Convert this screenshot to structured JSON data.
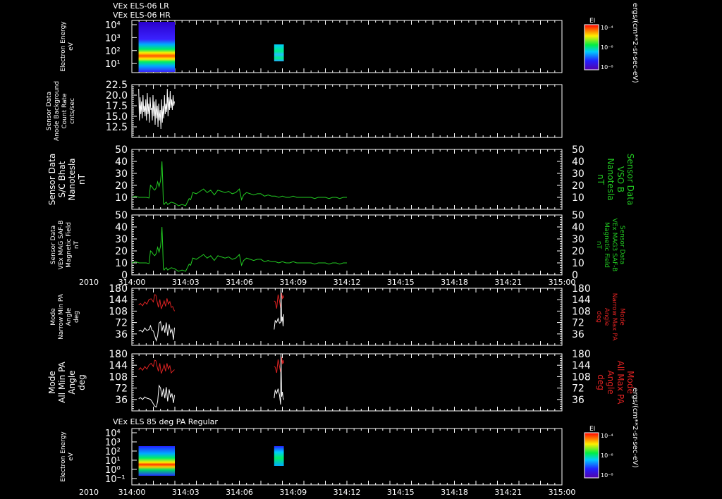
{
  "colors": {
    "background": "#000000",
    "axis": "#ffffff",
    "trace_white": "#ffffff",
    "trace_green": "#22cc22",
    "trace_red": "#dd2222",
    "label_green": "#22cc22",
    "label_red": "#dd2222"
  },
  "header": {
    "line1": "VEx ELS-06 LR",
    "line2": "VEx ELS-06 HR"
  },
  "colorbar_unit": "ergs/(cm**2-sr-sec-eV)",
  "chart_data": [
    {
      "id": "p1",
      "type": "heatmap",
      "ylabel": [
        "Electron Energy",
        "eV"
      ],
      "log_y": true,
      "ytick_labels": [
        "10⁴",
        "10³",
        "10²",
        "10¹"
      ],
      "blocks": [
        {
          "t0": 0.94,
          "t1": 6.0,
          "label": "ELS spectrogram"
        },
        {
          "t0": 19.85,
          "t1": 21.2,
          "label": "ELS spectrogram"
        }
      ],
      "colorbar": {
        "title": "EI",
        "ticks": [
          "10⁻⁴",
          "10⁻⁶",
          "10⁻⁸"
        ]
      }
    },
    {
      "id": "p2",
      "type": "line",
      "ylabel": [
        "Sensor Data",
        "Anode Background",
        "Count Rate",
        "cnts/sec"
      ],
      "ylim": [
        10.0,
        22.5
      ],
      "yticks": [
        "22.5",
        "20.0",
        "17.5",
        "15.0",
        "12.5"
      ],
      "series": [
        {
          "color": "white",
          "x": [
            0.95,
            1.05,
            1.15,
            1.25,
            1.35,
            1.45,
            1.55,
            1.65,
            1.75,
            1.85,
            1.95,
            2.05,
            2.15,
            2.25,
            2.35,
            2.45,
            2.55,
            2.65,
            2.75,
            2.85,
            2.95,
            3.05,
            3.15,
            3.25,
            3.35,
            3.45,
            3.55,
            3.65,
            3.75,
            3.85,
            3.95,
            4.05,
            4.15,
            4.25,
            4.35,
            4.45,
            4.55,
            4.65,
            4.75,
            4.85,
            4.95,
            5.05,
            5.15,
            5.25,
            5.35,
            5.45,
            5.55,
            5.65,
            5.75,
            5.85,
            5.95
          ],
          "y": [
            21.5,
            14.0,
            19.5,
            15.5,
            18.5,
            14.5,
            20.0,
            16.0,
            17.5,
            15.0,
            19.0,
            14.0,
            20.5,
            15.5,
            18.0,
            13.5,
            19.5,
            16.5,
            17.0,
            14.0,
            20.0,
            15.0,
            18.5,
            13.0,
            19.0,
            14.5,
            17.5,
            12.5,
            18.0,
            14.0,
            16.5,
            12.0,
            19.0,
            13.5,
            17.5,
            14.5,
            20.0,
            15.5,
            18.0,
            16.0,
            21.5,
            15.0,
            19.5,
            16.5,
            21.0,
            17.0,
            19.0,
            16.5,
            20.0,
            17.5,
            18.5
          ]
        }
      ]
    },
    {
      "id": "p3",
      "type": "line",
      "ylabel": [
        "Sensor Data",
        "S/C Bhat",
        "Nanotesla",
        "nT"
      ],
      "right_label": [
        "Sensor Data",
        "VSO B",
        "Nanotesla",
        "nT"
      ],
      "ylim": [
        0,
        50
      ],
      "yticks": [
        "50",
        "40",
        "30",
        "20",
        "10"
      ],
      "series": [
        {
          "color": "green",
          "x": [
            0,
            0.5,
            1,
            1.5,
            2,
            2.4,
            2.6,
            2.8,
            3.0,
            3.2,
            3.4,
            3.6,
            3.8,
            4.0,
            4.1,
            4.2,
            4.25,
            4.3,
            4.4,
            4.5,
            4.6,
            4.8,
            5,
            5.5,
            6,
            6.5,
            7,
            7.5,
            8,
            8.2,
            8.5,
            9,
            9.5,
            10,
            10.5,
            11,
            11.5,
            12,
            12.5,
            13,
            13.5,
            14,
            14.5,
            15,
            15.3,
            15.6,
            16,
            16.5,
            17,
            17.5,
            18,
            18.5,
            19,
            19.5,
            20,
            20.5,
            21,
            21.5,
            22,
            22.5,
            23,
            23.5,
            24,
            24.5,
            25,
            25.5,
            26,
            26.5,
            27,
            27.5,
            28,
            28.5,
            29,
            29.5,
            30
          ],
          "y": [
            10,
            11,
            10,
            10,
            10,
            9.5,
            20,
            19,
            17,
            16,
            18,
            23,
            19,
            24,
            30,
            40,
            33,
            25,
            5,
            4,
            5,
            6,
            4,
            6,
            5,
            3,
            4,
            3,
            9,
            8,
            14,
            13,
            15,
            17,
            14,
            16,
            12,
            16,
            15,
            14,
            15,
            13,
            14,
            17,
            8,
            12,
            14,
            13,
            12,
            13,
            13,
            11,
            12,
            11,
            11,
            10,
            11,
            10,
            10,
            11,
            10,
            10,
            10,
            10,
            10,
            9,
            10,
            10,
            10,
            9,
            10,
            10,
            9,
            10,
            10
          ]
        }
      ]
    },
    {
      "id": "p4",
      "type": "line",
      "ylabel": [
        "Sensor Data",
        "VEx MAG SAF-B",
        "Magnetic Field",
        "nT"
      ],
      "right_label": [
        "Sensor Data",
        "VEx MAG3 SAF-B",
        "Magnetic Field",
        "nT"
      ],
      "ylim": [
        0,
        50
      ],
      "yticks": [
        "50",
        "40",
        "30",
        "20",
        "10",
        "0"
      ],
      "series": [
        {
          "color": "green",
          "x": [
            0,
            0.5,
            1,
            1.5,
            2,
            2.4,
            2.6,
            2.8,
            3.0,
            3.2,
            3.4,
            3.6,
            3.8,
            4.0,
            4.1,
            4.2,
            4.25,
            4.3,
            4.4,
            4.5,
            4.6,
            4.8,
            5,
            5.5,
            6,
            6.5,
            7,
            7.5,
            8,
            8.2,
            8.5,
            9,
            9.5,
            10,
            10.5,
            11,
            11.5,
            12,
            12.5,
            13,
            13.5,
            14,
            14.5,
            15,
            15.3,
            15.6,
            16,
            16.5,
            17,
            17.5,
            18,
            18.5,
            19,
            19.5,
            20,
            20.5,
            21,
            21.5,
            22,
            22.5,
            23,
            23.5,
            24,
            24.5,
            25,
            25.5,
            26,
            26.5,
            27,
            27.5,
            28,
            28.5,
            29,
            29.5,
            30
          ],
          "y": [
            10,
            11,
            10,
            10,
            10,
            9.5,
            20,
            19,
            17,
            16,
            18,
            23,
            19,
            24,
            30,
            40,
            33,
            25,
            5,
            4,
            5,
            6,
            4,
            6,
            5,
            3,
            4,
            3,
            9,
            8,
            14,
            13,
            15,
            17,
            14,
            16,
            12,
            16,
            15,
            14,
            15,
            13,
            14,
            17,
            8,
            12,
            14,
            13,
            12,
            13,
            13,
            11,
            12,
            11,
            11,
            10,
            11,
            10,
            10,
            11,
            10,
            10,
            10,
            10,
            10,
            9,
            10,
            10,
            10,
            9,
            10,
            10,
            9,
            10,
            10
          ]
        }
      ],
      "xaxis": {
        "year": "2010",
        "ticks": [
          "314:00",
          "314:03",
          "314:06",
          "314:09",
          "314:12",
          "314:15",
          "314:18",
          "314:21",
          "315:00"
        ]
      }
    },
    {
      "id": "p5",
      "type": "line",
      "ylabel": [
        "Mode",
        "Narrow Min PA",
        "Angle",
        "deg"
      ],
      "right_label": [
        "Mode",
        "Narrow Max PA",
        "Angle",
        "deg"
      ],
      "ylim": [
        0,
        180
      ],
      "yticks": [
        "180",
        "144",
        "108",
        "72",
        "36"
      ],
      "series": [
        {
          "color": "red",
          "x": [
            0.95,
            1.2,
            1.5,
            1.8,
            2.1,
            2.4,
            2.7,
            3.0,
            3.2,
            3.35,
            3.5,
            3.7,
            3.9,
            4.1,
            4.3,
            4.5,
            4.7,
            4.9,
            5.1,
            5.3,
            5.5,
            5.7,
            5.95
          ],
          "y": [
            127,
            132,
            125,
            137,
            130,
            145,
            147,
            137,
            160,
            158,
            141,
            120,
            145,
            115,
            127,
            140,
            123,
            148,
            130,
            138,
            120,
            122,
            108
          ]
        },
        {
          "color": "white",
          "x": [
            0.95,
            1.2,
            1.5,
            1.8,
            2.1,
            2.4,
            2.6,
            2.8,
            3.0,
            3.2,
            3.4,
            3.6,
            3.8,
            4.0,
            4.2,
            4.4,
            4.6,
            4.8,
            5.0,
            5.2,
            5.4,
            5.6,
            5.8,
            5.95
          ],
          "y": [
            45,
            48,
            42,
            55,
            47,
            50,
            62,
            48,
            45,
            30,
            15,
            30,
            70,
            75,
            45,
            64,
            40,
            72,
            30,
            66,
            40,
            50,
            18,
            56
          ]
        },
        {
          "color": "red",
          "x": [
            19.85,
            20.0,
            20.2,
            20.4,
            20.6,
            20.75,
            20.9,
            21.0,
            21.1,
            21.2
          ],
          "y": [
            140,
            138,
            116,
            160,
            140,
            118,
            165,
            146,
            156,
            150
          ]
        },
        {
          "color": "white",
          "x": [
            19.85,
            20.0,
            20.2,
            20.4,
            20.6,
            20.75,
            20.8,
            20.9,
            21.0,
            21.1,
            21.2
          ],
          "y": [
            50,
            78,
            72,
            85,
            70,
            72,
            180,
            75,
            90,
            60,
            98
          ]
        }
      ]
    },
    {
      "id": "p6",
      "type": "line",
      "ylabel": [
        "Mode",
        "All Min PA",
        "Angle",
        "deg"
      ],
      "right_label": [
        "Mode",
        "All Max PA",
        "Angle",
        "deg"
      ],
      "ylim": [
        0,
        180
      ],
      "yticks": [
        "180",
        "144",
        "108",
        "72",
        "36"
      ],
      "series": [
        {
          "color": "red",
          "x": [
            0.95,
            1.2,
            1.5,
            1.8,
            2.1,
            2.4,
            2.7,
            3.0,
            3.2,
            3.35,
            3.5,
            3.7,
            3.9,
            4.1,
            4.3,
            4.5,
            4.7,
            4.9,
            5.1,
            5.3,
            5.5,
            5.7,
            5.95
          ],
          "y": [
            130,
            136,
            128,
            140,
            132,
            145,
            150,
            140,
            160,
            158,
            142,
            125,
            150,
            118,
            130,
            145,
            125,
            150,
            132,
            142,
            120,
            125,
            130
          ]
        },
        {
          "color": "white",
          "x": [
            0.95,
            1.2,
            1.5,
            1.8,
            2.1,
            2.4,
            2.6,
            2.8,
            3.0,
            3.2,
            3.4,
            3.6,
            3.8,
            4.0,
            4.2,
            4.4,
            4.6,
            4.8,
            5.0,
            5.2,
            5.4,
            5.6,
            5.8,
            5.95
          ],
          "y": [
            38,
            42,
            36,
            44,
            40,
            38,
            36,
            30,
            22,
            15,
            12,
            30,
            80,
            72,
            45,
            70,
            40,
            75,
            30,
            68,
            42,
            55,
            25,
            50
          ]
        },
        {
          "color": "red",
          "x": [
            19.85,
            20.0,
            20.2,
            20.4,
            20.6,
            20.75,
            20.9,
            21.0,
            21.1,
            21.2
          ],
          "y": [
            140,
            138,
            120,
            162,
            140,
            122,
            170,
            148,
            160,
            150
          ]
        },
        {
          "color": "white",
          "x": [
            19.85,
            20.0,
            20.2,
            20.4,
            20.6,
            20.75,
            20.8,
            20.9,
            21.0,
            21.1,
            21.2
          ],
          "y": [
            40,
            65,
            55,
            70,
            50,
            20,
            180,
            45,
            60,
            40,
            35
          ]
        }
      ]
    },
    {
      "id": "p7",
      "type": "heatmap",
      "title": "VEx ELS 85 deg PA Regular",
      "ylabel": [
        "Electron Energy",
        "eV"
      ],
      "log_y": true,
      "ytick_labels": [
        "10⁴",
        "10³",
        "10²",
        "10¹",
        "10⁰",
        "10⁻¹"
      ],
      "blocks": [
        {
          "t0": 0.94,
          "t1": 6.0,
          "label": "ELS spectrogram"
        },
        {
          "t0": 19.85,
          "t1": 21.2,
          "label": "ELS spectrogram"
        }
      ],
      "colorbar": {
        "title": "EI",
        "ticks": [
          "10⁻⁴",
          "10⁻⁶",
          "10⁻⁸"
        ]
      },
      "xaxis": {
        "year": "2010",
        "ticks": [
          "314:00",
          "314:03",
          "314:06",
          "314:09",
          "314:12",
          "314:15",
          "314:18",
          "314:21",
          "315:00"
        ]
      }
    }
  ]
}
